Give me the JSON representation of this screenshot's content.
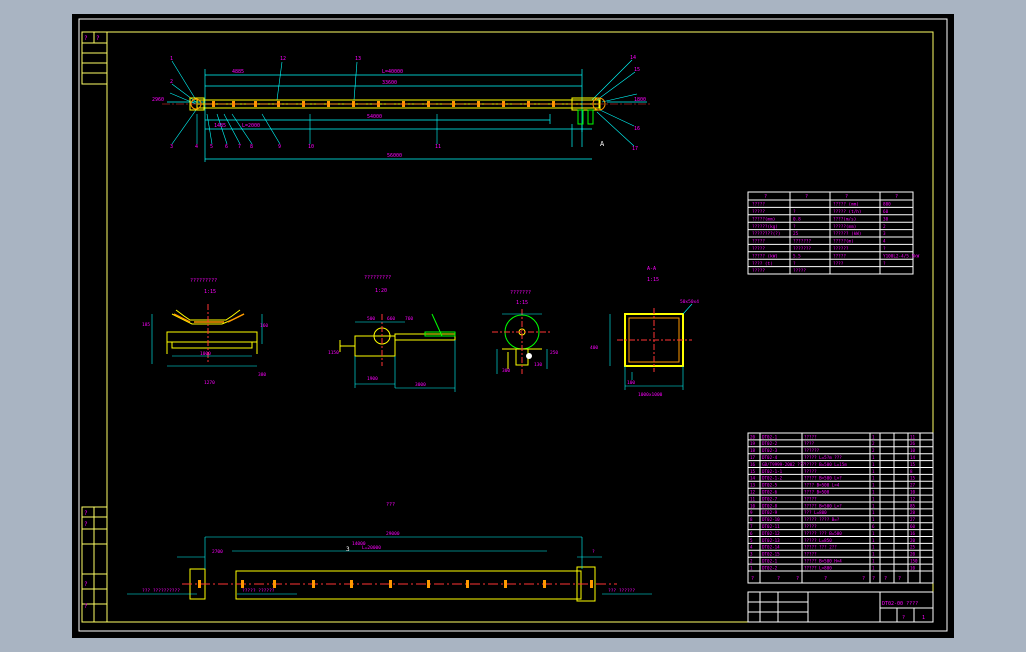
{
  "colors": {
    "viewport": "#a9b4c2",
    "paper": "#000000",
    "frame": "#ffffff",
    "border": "#ffff66",
    "outline": "#ffff00",
    "dim": "#00ffff",
    "text": "#ff00ff",
    "center": "#ff3333",
    "idler": "#ff9900",
    "green": "#00ff00"
  },
  "side_view": {
    "dims": [
      "L=40000",
      "4885",
      "33600",
      "54000",
      "56000",
      "2960",
      "1800",
      "1485",
      "L=2000"
    ],
    "leaders": [
      "1",
      "2",
      "3",
      "4",
      "5",
      "6",
      "7",
      "8",
      "9",
      "10",
      "11",
      "12",
      "13",
      "14",
      "15",
      "16",
      "17",
      "18",
      "19",
      "20",
      "21",
      "22",
      "23"
    ],
    "section_mark": "A"
  },
  "details": [
    {
      "title": "?????????",
      "scale": "1:15",
      "dims": [
        "1000",
        "1270",
        "185",
        "160",
        "380",
        "R"
      ]
    },
    {
      "title": "?????????",
      "scale": "1:20",
      "dims": [
        "500",
        "660",
        "760",
        "1900",
        "3000",
        "1150"
      ]
    },
    {
      "title": "???????",
      "scale": "1:15",
      "dims": [
        "250",
        "130",
        "300",
        "45"
      ]
    },
    {
      "title": "A-A",
      "scale": "1:15",
      "dims": [
        "1000x1000",
        "100",
        "50x50x4",
        "400"
      ]
    }
  ],
  "tech_table": {
    "headers": [
      "?",
      "?",
      "?",
      "?"
    ],
    "rows": [
      [
        "?????",
        "",
        "????? (mm)",
        "800"
      ],
      [
        "?????",
        "?",
        "????? (t/h)",
        "60"
      ],
      [
        "?????(mm)",
        "0.8",
        "????(m/s)",
        "30"
      ],
      [
        "??????(kg)",
        "?",
        "?????(mm)",
        "2"
      ],
      [
        "????????(?)",
        "25",
        "?????? (kW)",
        "3"
      ],
      [
        "?????",
        "???????",
        "?????(m)",
        "4"
      ],
      [
        "?????",
        "???????",
        "??????",
        "?"
      ],
      [
        "????? (kW)",
        "5.5",
        "?????",
        "Y100L2-4/5.5kW"
      ],
      [
        "???? (t)",
        "?",
        "????",
        "?"
      ],
      [
        "?????",
        "?????",
        "",
        ""
      ]
    ]
  },
  "bom_table": {
    "rows": [
      [
        "20",
        "DT02-1",
        "?????",
        "1",
        "",
        "11"
      ],
      [
        "19",
        "DT02-2",
        "????",
        "2",
        "",
        "26"
      ],
      [
        "18",
        "DT02-3",
        "??????",
        "2",
        "",
        "10"
      ],
      [
        "17",
        "DT02-4",
        "????? L=5?m ???",
        "1",
        "",
        "14"
      ],
      [
        "16",
        "GB/T9999-2002 ???",
        "????? B=500 L=15m",
        "1",
        "",
        "15"
      ],
      [
        "15",
        "DT02-1-1",
        "?????",
        "1",
        "",
        "8"
      ],
      [
        "14",
        "DT02-1-2",
        "????? B=500 L=?",
        "1",
        "",
        "15"
      ],
      [
        "13",
        "DT02-5",
        "???? B=500 L=4",
        "1",
        "",
        "27"
      ],
      [
        "12",
        "DT02-6",
        "???? B=500",
        "1",
        "",
        "10"
      ],
      [
        "11",
        "DT02-7",
        "?????",
        "1",
        "",
        "12"
      ],
      [
        "10",
        "DT02-8",
        "????? B=500 L=?",
        "1",
        "",
        "85"
      ],
      [
        "9",
        "DT02-9",
        "??? L=800",
        "1",
        "",
        "28"
      ],
      [
        "8",
        "DT02-10",
        "????? ???? B=?",
        "1",
        "",
        "27"
      ],
      [
        "7",
        "DT02-11",
        "?????",
        "6",
        "",
        "60"
      ],
      [
        "6",
        "DT02-12",
        "????? ??? B=500",
        "1",
        "",
        "16"
      ],
      [
        "5",
        "DT02-13",
        "????? L=850",
        "1",
        "",
        "20"
      ],
      [
        "4",
        "DT02-14",
        "????? ??? 2??",
        "1",
        "",
        "25"
      ],
      [
        "3",
        "DT02-15",
        "?????",
        "1",
        "",
        "20"
      ],
      [
        "2",
        "DT02-1",
        "????? B=500 H=4",
        "1",
        "",
        "150"
      ],
      [
        "1",
        "DT02-2",
        "????? L=800",
        "1",
        "",
        "10"
      ]
    ],
    "header": [
      "?",
      "?",
      "?",
      "?",
      "?",
      "?",
      "?",
      "?"
    ]
  },
  "title_block": {
    "drawing_no": "DT02-00 ????",
    "scale_label": "?",
    "sheet": "1"
  },
  "plan_view": {
    "label": "???",
    "dims": [
      "29000",
      "L=20000",
      "14000",
      "3",
      "2700",
      "?"
    ],
    "notes": [
      "??? ??????????",
      "????? ??????",
      "??? ??????"
    ]
  },
  "left_strip": {
    "marks": [
      "?",
      "?",
      "?",
      "?",
      "?",
      "?"
    ]
  }
}
